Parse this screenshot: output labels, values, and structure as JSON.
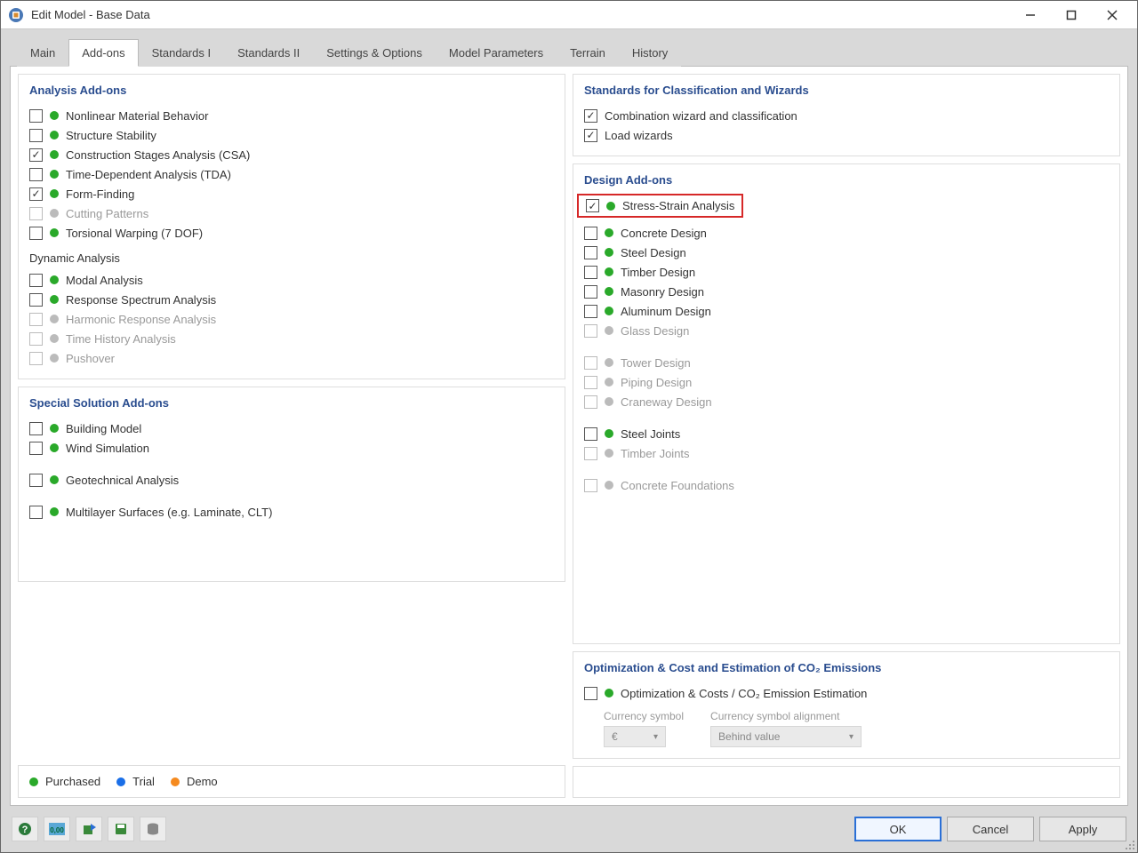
{
  "window": {
    "title": "Edit Model - Base Data"
  },
  "tabs": {
    "items": [
      "Main",
      "Add-ons",
      "Standards I",
      "Standards II",
      "Settings & Options",
      "Model Parameters",
      "Terrain",
      "History"
    ],
    "active": "Add-ons"
  },
  "left": {
    "analysis": {
      "title": "Analysis Add-ons",
      "items": [
        {
          "label": "Nonlinear Material Behavior",
          "checked": false,
          "status": "green"
        },
        {
          "label": "Structure Stability",
          "checked": false,
          "status": "green"
        },
        {
          "label": "Construction Stages Analysis (CSA)",
          "checked": true,
          "status": "green"
        },
        {
          "label": "Time-Dependent Analysis (TDA)",
          "checked": false,
          "status": "green"
        },
        {
          "label": "Form-Finding",
          "checked": true,
          "status": "green"
        },
        {
          "label": "Cutting Patterns",
          "checked": false,
          "status": "gray",
          "disabled": true
        },
        {
          "label": "Torsional Warping (7 DOF)",
          "checked": false,
          "status": "green"
        }
      ],
      "dynamic_title": "Dynamic Analysis",
      "dynamic": [
        {
          "label": "Modal Analysis",
          "checked": false,
          "status": "green"
        },
        {
          "label": "Response Spectrum Analysis",
          "checked": false,
          "status": "green"
        },
        {
          "label": "Harmonic Response Analysis",
          "checked": false,
          "status": "gray",
          "disabled": true
        },
        {
          "label": "Time History Analysis",
          "checked": false,
          "status": "gray",
          "disabled": true
        },
        {
          "label": "Pushover",
          "checked": false,
          "status": "gray",
          "disabled": true
        }
      ]
    },
    "special": {
      "title": "Special Solution Add-ons",
      "items": [
        {
          "label": "Building Model",
          "checked": false,
          "status": "green"
        },
        {
          "label": "Wind Simulation",
          "checked": false,
          "status": "green"
        },
        {
          "label": "Geotechnical Analysis",
          "checked": false,
          "status": "green",
          "gap": true
        },
        {
          "label": "Multilayer Surfaces (e.g. Laminate, CLT)",
          "checked": false,
          "status": "green",
          "gap": true
        }
      ]
    },
    "legend": {
      "purchased": "Purchased",
      "trial": "Trial",
      "demo": "Demo"
    }
  },
  "right": {
    "standards": {
      "title": "Standards for Classification and Wizards",
      "items": [
        {
          "label": "Combination wizard and classification",
          "checked": true
        },
        {
          "label": "Load wizards",
          "checked": true
        }
      ]
    },
    "design": {
      "title": "Design Add-ons",
      "highlight": {
        "label": "Stress-Strain Analysis",
        "checked": true,
        "status": "green"
      },
      "group1": [
        {
          "label": "Concrete Design",
          "checked": false,
          "status": "green"
        },
        {
          "label": "Steel Design",
          "checked": false,
          "status": "green"
        },
        {
          "label": "Timber Design",
          "checked": false,
          "status": "green"
        },
        {
          "label": "Masonry Design",
          "checked": false,
          "status": "green"
        },
        {
          "label": "Aluminum Design",
          "checked": false,
          "status": "green"
        },
        {
          "label": "Glass Design",
          "checked": false,
          "status": "gray",
          "disabled": true
        }
      ],
      "group2": [
        {
          "label": "Tower Design",
          "checked": false,
          "status": "gray",
          "disabled": true
        },
        {
          "label": "Piping Design",
          "checked": false,
          "status": "gray",
          "disabled": true
        },
        {
          "label": "Craneway Design",
          "checked": false,
          "status": "gray",
          "disabled": true
        }
      ],
      "group3": [
        {
          "label": "Steel Joints",
          "checked": false,
          "status": "green"
        },
        {
          "label": "Timber Joints",
          "checked": false,
          "status": "gray",
          "disabled": true
        }
      ],
      "group4": [
        {
          "label": "Concrete Foundations",
          "checked": false,
          "status": "gray",
          "disabled": true
        }
      ]
    },
    "opt": {
      "title": "Optimization & Cost and Estimation of CO₂ Emissions",
      "item": {
        "label": "Optimization & Costs / CO₂ Emission Estimation",
        "checked": false,
        "status": "green"
      },
      "currency_label": "Currency symbol",
      "currency_value": "€",
      "align_label": "Currency symbol alignment",
      "align_value": "Behind value"
    }
  },
  "footer": {
    "ok": "OK",
    "cancel": "Cancel",
    "apply": "Apply"
  }
}
